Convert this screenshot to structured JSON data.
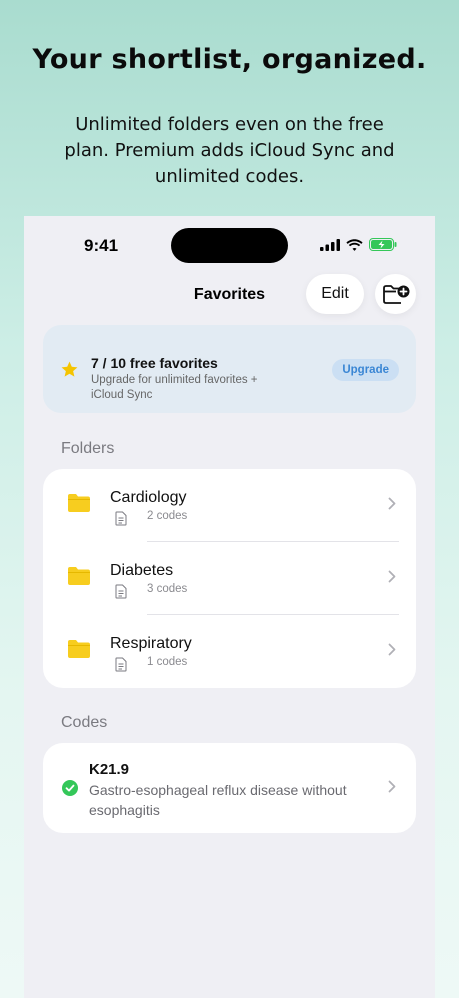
{
  "headline": "Your shortlist, organized.",
  "subhead": "Unlimited folders even on the free plan. Premium adds iCloud Sync and unlimited codes.",
  "status_bar": {
    "time": "9:41"
  },
  "nav": {
    "title": "Favorites",
    "edit_label": "Edit"
  },
  "banner": {
    "title": "7 / 10 free favorites",
    "subtitle": "Upgrade for unlimited favorites + iCloud Sync",
    "upgrade_label": "Upgrade"
  },
  "folders_section": {
    "label": "Folders",
    "items": [
      {
        "name": "Cardiology",
        "count": "2 codes"
      },
      {
        "name": "Diabetes",
        "count": "3 codes"
      },
      {
        "name": "Respiratory",
        "count": "1 codes"
      }
    ]
  },
  "codes_section": {
    "label": "Codes",
    "items": [
      {
        "code": "K21.9",
        "description": "Gastro-esophageal reflux disease without esophagitis"
      }
    ]
  },
  "colors": {
    "accent_blue": "#3a86d4",
    "star_yellow": "#f5c400",
    "folder_yellow": "#f7cd1f",
    "check_green": "#34c759",
    "battery_green": "#34c759"
  }
}
